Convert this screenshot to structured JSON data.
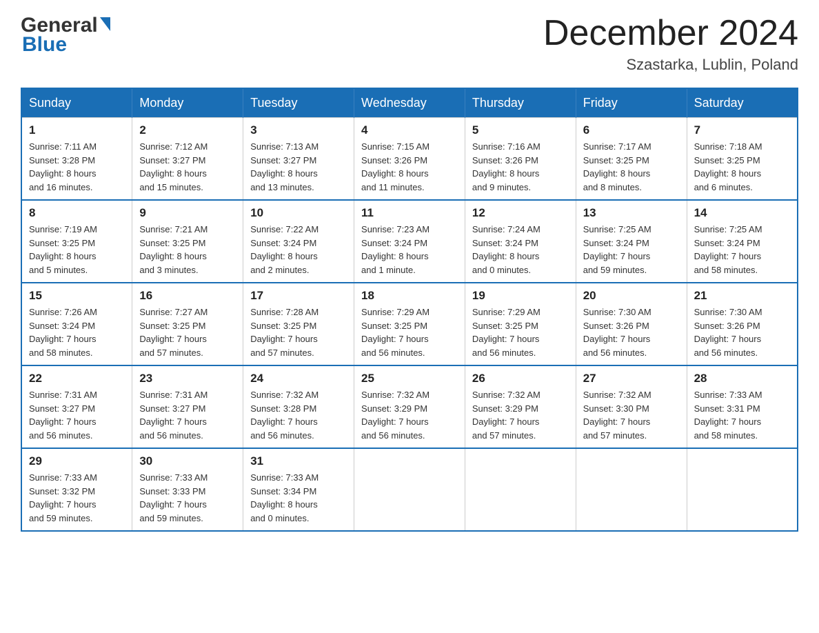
{
  "header": {
    "logo_general": "General",
    "logo_blue": "Blue",
    "month_title": "December 2024",
    "location": "Szastarka, Lublin, Poland"
  },
  "days_of_week": [
    "Sunday",
    "Monday",
    "Tuesday",
    "Wednesday",
    "Thursday",
    "Friday",
    "Saturday"
  ],
  "weeks": [
    [
      {
        "day": 1,
        "sunrise": "7:11 AM",
        "sunset": "3:28 PM",
        "daylight": "8 hours and 16 minutes."
      },
      {
        "day": 2,
        "sunrise": "7:12 AM",
        "sunset": "3:27 PM",
        "daylight": "8 hours and 15 minutes."
      },
      {
        "day": 3,
        "sunrise": "7:13 AM",
        "sunset": "3:27 PM",
        "daylight": "8 hours and 13 minutes."
      },
      {
        "day": 4,
        "sunrise": "7:15 AM",
        "sunset": "3:26 PM",
        "daylight": "8 hours and 11 minutes."
      },
      {
        "day": 5,
        "sunrise": "7:16 AM",
        "sunset": "3:26 PM",
        "daylight": "8 hours and 9 minutes."
      },
      {
        "day": 6,
        "sunrise": "7:17 AM",
        "sunset": "3:25 PM",
        "daylight": "8 hours and 8 minutes."
      },
      {
        "day": 7,
        "sunrise": "7:18 AM",
        "sunset": "3:25 PM",
        "daylight": "8 hours and 6 minutes."
      }
    ],
    [
      {
        "day": 8,
        "sunrise": "7:19 AM",
        "sunset": "3:25 PM",
        "daylight": "8 hours and 5 minutes."
      },
      {
        "day": 9,
        "sunrise": "7:21 AM",
        "sunset": "3:25 PM",
        "daylight": "8 hours and 3 minutes."
      },
      {
        "day": 10,
        "sunrise": "7:22 AM",
        "sunset": "3:24 PM",
        "daylight": "8 hours and 2 minutes."
      },
      {
        "day": 11,
        "sunrise": "7:23 AM",
        "sunset": "3:24 PM",
        "daylight": "8 hours and 1 minute."
      },
      {
        "day": 12,
        "sunrise": "7:24 AM",
        "sunset": "3:24 PM",
        "daylight": "8 hours and 0 minutes."
      },
      {
        "day": 13,
        "sunrise": "7:25 AM",
        "sunset": "3:24 PM",
        "daylight": "7 hours and 59 minutes."
      },
      {
        "day": 14,
        "sunrise": "7:25 AM",
        "sunset": "3:24 PM",
        "daylight": "7 hours and 58 minutes."
      }
    ],
    [
      {
        "day": 15,
        "sunrise": "7:26 AM",
        "sunset": "3:24 PM",
        "daylight": "7 hours and 58 minutes."
      },
      {
        "day": 16,
        "sunrise": "7:27 AM",
        "sunset": "3:25 PM",
        "daylight": "7 hours and 57 minutes."
      },
      {
        "day": 17,
        "sunrise": "7:28 AM",
        "sunset": "3:25 PM",
        "daylight": "7 hours and 57 minutes."
      },
      {
        "day": 18,
        "sunrise": "7:29 AM",
        "sunset": "3:25 PM",
        "daylight": "7 hours and 56 minutes."
      },
      {
        "day": 19,
        "sunrise": "7:29 AM",
        "sunset": "3:25 PM",
        "daylight": "7 hours and 56 minutes."
      },
      {
        "day": 20,
        "sunrise": "7:30 AM",
        "sunset": "3:26 PM",
        "daylight": "7 hours and 56 minutes."
      },
      {
        "day": 21,
        "sunrise": "7:30 AM",
        "sunset": "3:26 PM",
        "daylight": "7 hours and 56 minutes."
      }
    ],
    [
      {
        "day": 22,
        "sunrise": "7:31 AM",
        "sunset": "3:27 PM",
        "daylight": "7 hours and 56 minutes."
      },
      {
        "day": 23,
        "sunrise": "7:31 AM",
        "sunset": "3:27 PM",
        "daylight": "7 hours and 56 minutes."
      },
      {
        "day": 24,
        "sunrise": "7:32 AM",
        "sunset": "3:28 PM",
        "daylight": "7 hours and 56 minutes."
      },
      {
        "day": 25,
        "sunrise": "7:32 AM",
        "sunset": "3:29 PM",
        "daylight": "7 hours and 56 minutes."
      },
      {
        "day": 26,
        "sunrise": "7:32 AM",
        "sunset": "3:29 PM",
        "daylight": "7 hours and 57 minutes."
      },
      {
        "day": 27,
        "sunrise": "7:32 AM",
        "sunset": "3:30 PM",
        "daylight": "7 hours and 57 minutes."
      },
      {
        "day": 28,
        "sunrise": "7:33 AM",
        "sunset": "3:31 PM",
        "daylight": "7 hours and 58 minutes."
      }
    ],
    [
      {
        "day": 29,
        "sunrise": "7:33 AM",
        "sunset": "3:32 PM",
        "daylight": "7 hours and 59 minutes."
      },
      {
        "day": 30,
        "sunrise": "7:33 AM",
        "sunset": "3:33 PM",
        "daylight": "7 hours and 59 minutes."
      },
      {
        "day": 31,
        "sunrise": "7:33 AM",
        "sunset": "3:34 PM",
        "daylight": "8 hours and 0 minutes."
      },
      null,
      null,
      null,
      null
    ]
  ],
  "labels": {
    "sunrise": "Sunrise:",
    "sunset": "Sunset:",
    "daylight": "Daylight:"
  }
}
